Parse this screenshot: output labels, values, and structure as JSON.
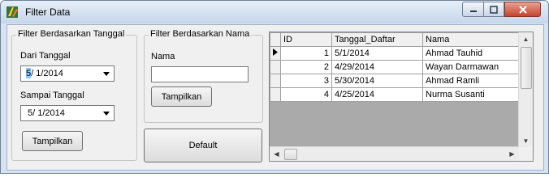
{
  "window": {
    "title": "Filter Data",
    "controls": {
      "minimize": "0",
      "maximize": "1",
      "close": "r"
    }
  },
  "filter_date": {
    "legend": "Filter Berdasarkan Tanggal",
    "from_label": "Dari Tanggal",
    "from_value": "5/ 1/2014",
    "to_label": "Sampai Tanggal",
    "to_value": "5/ 1/2014",
    "show_button": "Tampilkan"
  },
  "filter_name": {
    "legend": "Filter Berdasarkan Nama",
    "name_label": "Nama",
    "name_value": "",
    "show_button": "Tampilkan"
  },
  "default_button": "Default",
  "grid": {
    "columns": [
      "ID",
      "Tanggal_Daftar",
      "Nama"
    ],
    "rows": [
      {
        "id": "1",
        "date": "5/1/2014",
        "name": "Ahmad Tauhid",
        "current": true
      },
      {
        "id": "2",
        "date": "4/29/2014",
        "name": "Wayan Darmawan",
        "current": false
      },
      {
        "id": "3",
        "date": "5/30/2014",
        "name": "Ahmad Ramli",
        "current": false
      },
      {
        "id": "4",
        "date": "4/25/2014",
        "name": "Nurma Susanti",
        "current": false
      }
    ]
  },
  "icons": {
    "app": "app-icon",
    "dropdown": "chevron-down-icon",
    "row_pointer": "row-pointer-icon"
  }
}
